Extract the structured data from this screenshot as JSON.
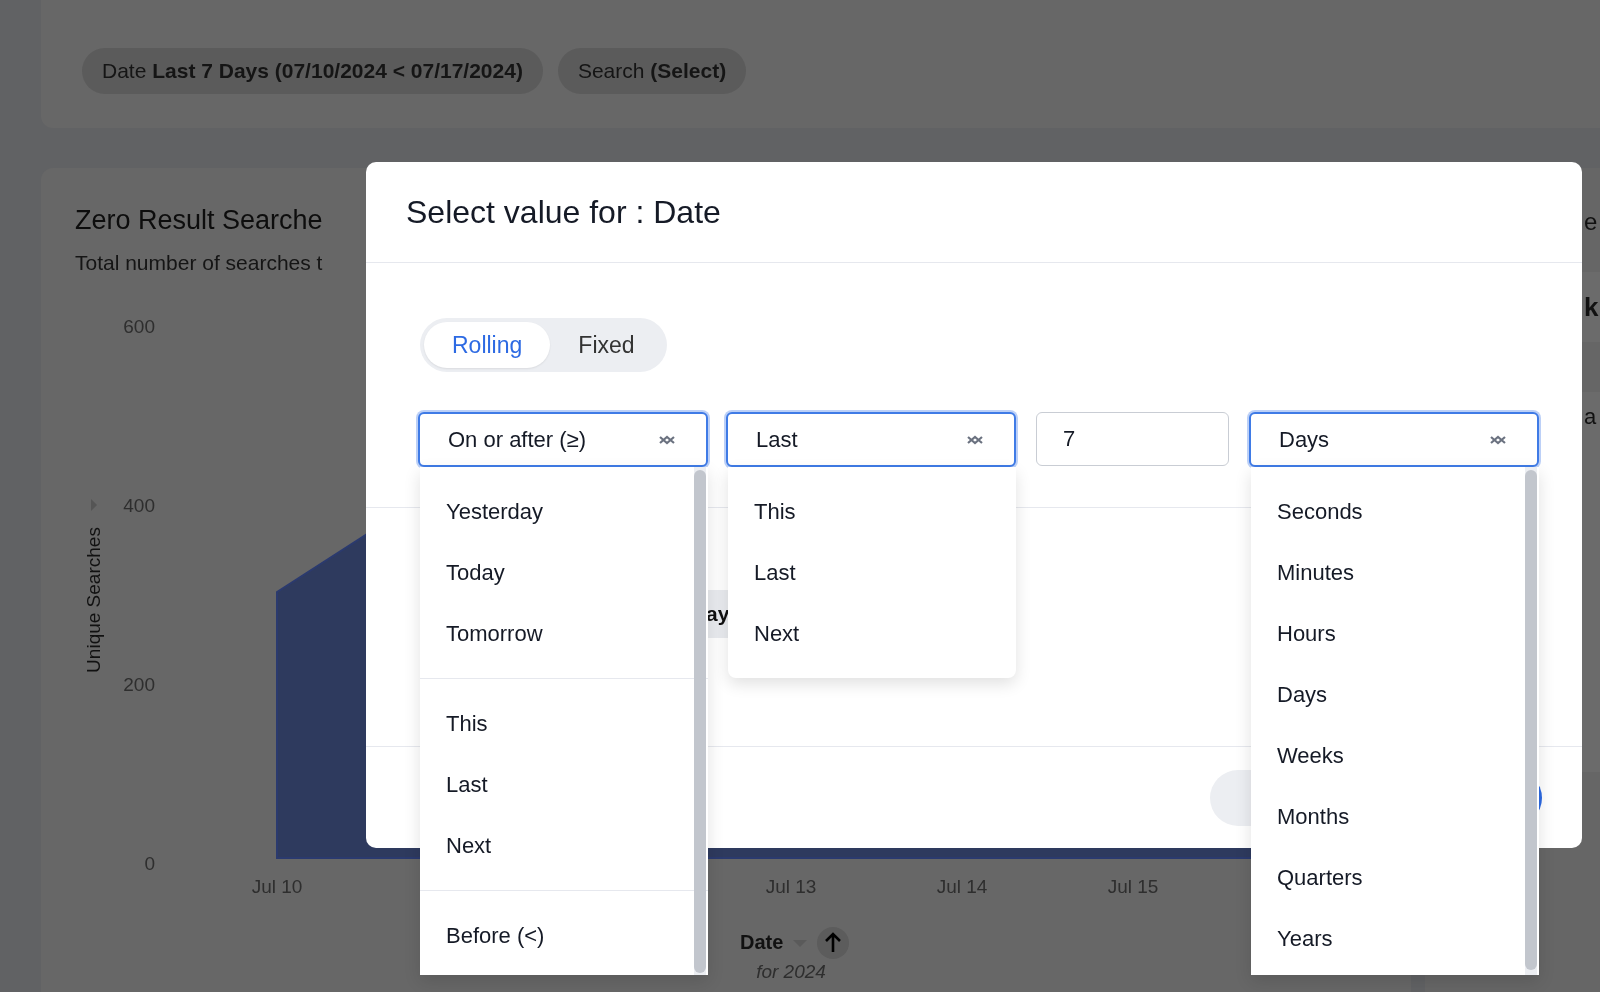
{
  "filter_bar": {
    "chips": [
      {
        "label": "Date",
        "value": "Last 7 Days (07/10/2024 < 07/17/2024)"
      },
      {
        "label": "Search",
        "value": "(Select)"
      }
    ]
  },
  "chart_card": {
    "title": "Zero Result Searche",
    "subtitle": "Total number of searches t",
    "y_axis_title": "Unique Searches",
    "y_ticks": [
      "600",
      "400",
      "200",
      "0"
    ],
    "x_labels": [
      "Jul 10",
      "Jul 13",
      "Jul 14",
      "Jul 15"
    ],
    "x_axis_label": "Date",
    "x_axis_sublabel": "for 2024"
  },
  "side_card": {
    "title_fragment": "e",
    "value_fragment": "k",
    "label_fragment": "a"
  },
  "dialog": {
    "title": "Select value for : Date",
    "modes": [
      {
        "label": "Rolling",
        "selected": true
      },
      {
        "label": "Fixed",
        "selected": false
      }
    ],
    "fields": [
      {
        "kind": "select",
        "value": "On or after (≥)",
        "open": true,
        "option_groups": [
          [
            "Yesterday",
            "Today",
            "Tomorrow"
          ],
          [
            "This",
            "Last",
            "Next"
          ],
          [
            "Before (<)"
          ]
        ]
      },
      {
        "kind": "select",
        "value": "Last",
        "open": true,
        "option_groups": [
          [
            "This",
            "Last",
            "Next"
          ]
        ]
      },
      {
        "kind": "input",
        "value": "7"
      },
      {
        "kind": "select",
        "value": "Days",
        "open": true,
        "option_groups": [
          [
            "Seconds",
            "Minutes",
            "Hours",
            "Days",
            "Weeks",
            "Months",
            "Quarters",
            "Years"
          ]
        ]
      }
    ],
    "preview_chip": "ay",
    "footer_buttons": [
      {
        "kind": "secondary"
      },
      {
        "kind": "primary"
      }
    ]
  }
}
